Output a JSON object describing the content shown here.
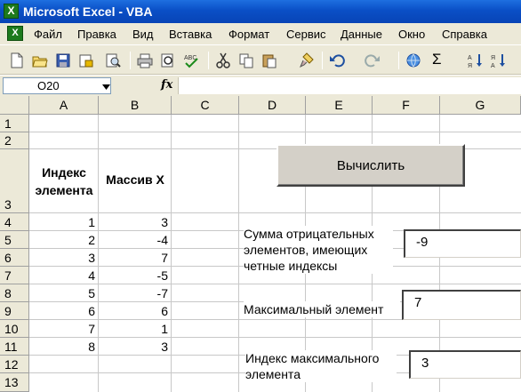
{
  "app": {
    "logo": "X",
    "title": "Microsoft Excel - VBA"
  },
  "menu": {
    "doc_icon": "X",
    "items": [
      "Файл",
      "Правка",
      "Вид",
      "Вставка",
      "Формат",
      "Сервис",
      "Данные",
      "Окно",
      "Справка"
    ]
  },
  "toolbar": {
    "icons": [
      "new-icon",
      "open-icon",
      "save-icon",
      "permission-icon",
      "print-preview-icon",
      "print-icon",
      "preview-icon",
      "spelling-icon",
      "cut-icon",
      "copy-icon",
      "paste-icon",
      "format-painter-icon",
      "undo-icon",
      "redo-icon",
      "hyperlink-icon",
      "autosum-icon",
      "sort-ascending-icon",
      "sort-descending-icon"
    ],
    "autosum_glyph": "Σ"
  },
  "formula_bar": {
    "cell_ref": "O20",
    "fx_label": "fx",
    "formula": ""
  },
  "columns": [
    "A",
    "B",
    "C",
    "D",
    "E",
    "F",
    "G"
  ],
  "rows": [
    "1",
    "2",
    "3",
    "4",
    "5",
    "6",
    "7",
    "8",
    "9",
    "10",
    "11",
    "12",
    "13"
  ],
  "sheet": {
    "header_a": "Индекс элемента",
    "header_b": "Массив X",
    "index_values": [
      "1",
      "2",
      "3",
      "4",
      "5",
      "6",
      "7",
      "8"
    ],
    "array_values": [
      "3",
      "-4",
      "7",
      "-5",
      "-7",
      "6",
      "1",
      "3"
    ]
  },
  "form": {
    "button_label": "Вычислить",
    "sum_label": "Сумма отрицательных элементов, имеющих четные индексы",
    "sum_value": "-9",
    "max_label": "Максимальный элемент",
    "max_value": "7",
    "max_index_label": "Индекс максимального элемента",
    "max_index_value": "3"
  }
}
